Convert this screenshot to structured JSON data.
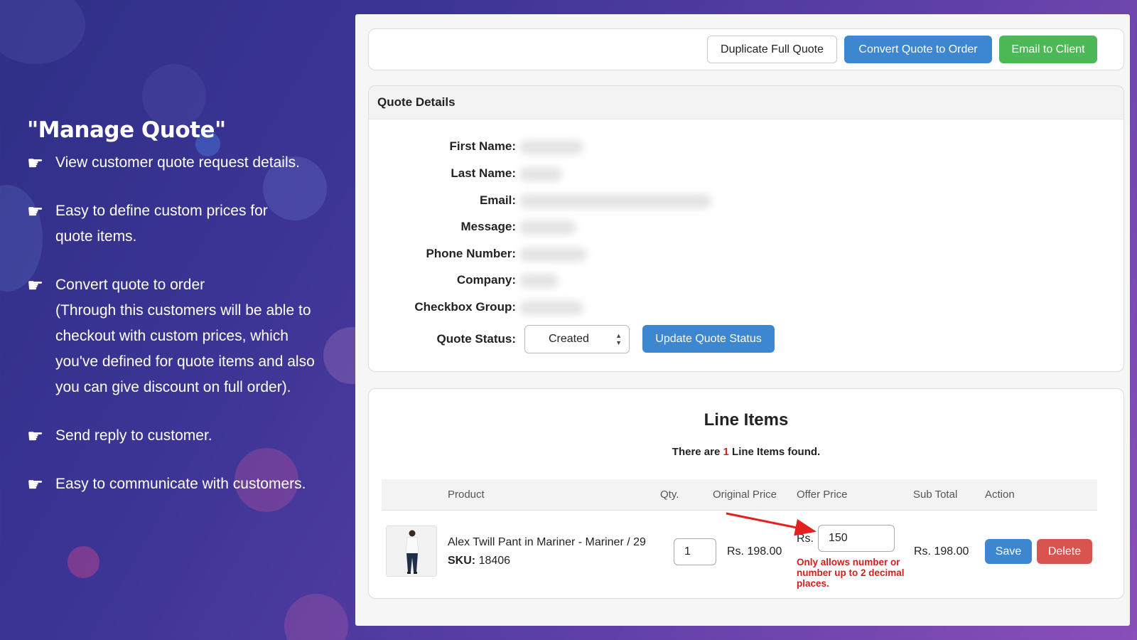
{
  "promo": {
    "title": "\"Manage Quote\"",
    "bullets": [
      "View customer quote request details.",
      "Easy to define custom prices for quote items.",
      "Convert quote to order\n(Through this customers will be able to checkout with custom prices, which you've defined for quote items and also you can give discount on full order).",
      "Send reply to customer.",
      "Easy to communicate with customers."
    ],
    "hand_icon": "pointing-hand-icon"
  },
  "actions": {
    "duplicate_label": "Duplicate Full Quote",
    "convert_label": "Convert Quote to Order",
    "email_label": "Email to Client"
  },
  "quote_details": {
    "header": "Quote Details",
    "fields": [
      {
        "label": "First Name:"
      },
      {
        "label": "Last Name:"
      },
      {
        "label": "Email:"
      },
      {
        "label": "Message:"
      },
      {
        "label": "Phone Number:"
      },
      {
        "label": "Company:"
      },
      {
        "label": "Checkbox Group:"
      }
    ],
    "status_label": "Quote Status:",
    "status_value": "Created",
    "update_label": "Update Quote Status"
  },
  "line_items": {
    "title": "Line Items",
    "found_prefix": "There are ",
    "found_count": "1",
    "found_suffix": " Line Items found.",
    "columns": [
      "Product",
      "Qty.",
      "Original Price",
      "Offer Price",
      "Sub Total",
      "Action"
    ],
    "rows": [
      {
        "product": "Alex Twill Pant in Mariner - Mariner / 29",
        "sku_label": "SKU:",
        "sku": "18406",
        "qty": "1",
        "original_price": "Rs. 198.00",
        "currency": "Rs.",
        "offer_price": "150",
        "sub_total": "Rs. 198.00",
        "save_label": "Save",
        "delete_label": "Delete"
      }
    ],
    "validation_note": "Only allows number or number up to 2 decimal places."
  },
  "colors": {
    "primary": "#3c87d0",
    "success": "#4cb856",
    "danger": "#d9534f",
    "note": "#d21f1f"
  }
}
